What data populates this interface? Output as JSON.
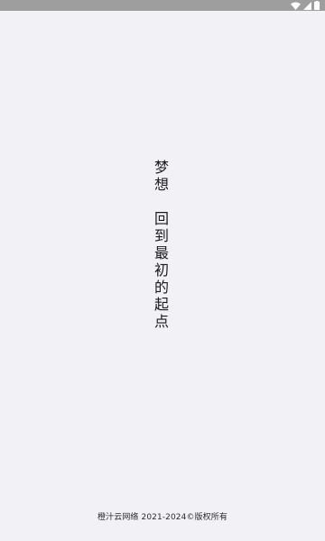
{
  "status_bar": {
    "icons": [
      "wifi-icon",
      "signal-icon",
      "battery-icon"
    ]
  },
  "splash": {
    "slogan_part1": "梦想",
    "slogan_part2": "回到最初的起点",
    "footer": "橙汁云网络 2021-2024©版权所有"
  },
  "colors": {
    "background": "#f2f1f6",
    "status_bar": "#9e9e9e",
    "text": "#1a1a1a"
  }
}
